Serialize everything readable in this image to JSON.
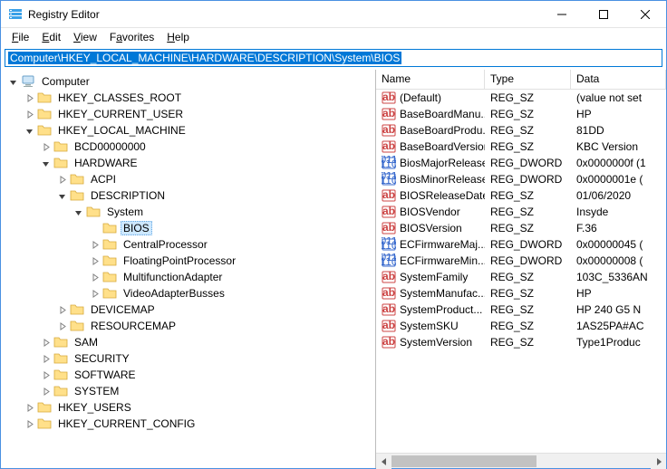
{
  "window": {
    "title": "Registry Editor"
  },
  "menu": {
    "file": "File",
    "edit": "Edit",
    "view": "View",
    "favorites": "Favorites",
    "help": "Help"
  },
  "address": {
    "path": "Computer\\HKEY_LOCAL_MACHINE\\HARDWARE\\DESCRIPTION\\System\\BIOS"
  },
  "tree": [
    {
      "label": "Computer",
      "depth": 0,
      "expanded": true,
      "icon": "computer",
      "selected": false
    },
    {
      "label": "HKEY_CLASSES_ROOT",
      "depth": 1,
      "expanded": false,
      "icon": "folder",
      "hasChildren": true
    },
    {
      "label": "HKEY_CURRENT_USER",
      "depth": 1,
      "expanded": false,
      "icon": "folder",
      "hasChildren": true
    },
    {
      "label": "HKEY_LOCAL_MACHINE",
      "depth": 1,
      "expanded": true,
      "icon": "folder",
      "hasChildren": true
    },
    {
      "label": "BCD00000000",
      "depth": 2,
      "expanded": false,
      "icon": "folder",
      "hasChildren": true
    },
    {
      "label": "HARDWARE",
      "depth": 2,
      "expanded": true,
      "icon": "folder",
      "hasChildren": true
    },
    {
      "label": "ACPI",
      "depth": 3,
      "expanded": false,
      "icon": "folder",
      "hasChildren": true
    },
    {
      "label": "DESCRIPTION",
      "depth": 3,
      "expanded": true,
      "icon": "folder",
      "hasChildren": true
    },
    {
      "label": "System",
      "depth": 4,
      "expanded": true,
      "icon": "folder",
      "hasChildren": true
    },
    {
      "label": "BIOS",
      "depth": 5,
      "expanded": false,
      "icon": "folder",
      "hasChildren": false,
      "selected": true
    },
    {
      "label": "CentralProcessor",
      "depth": 5,
      "expanded": false,
      "icon": "folder",
      "hasChildren": true
    },
    {
      "label": "FloatingPointProcessor",
      "depth": 5,
      "expanded": false,
      "icon": "folder",
      "hasChildren": true
    },
    {
      "label": "MultifunctionAdapter",
      "depth": 5,
      "expanded": false,
      "icon": "folder",
      "hasChildren": true
    },
    {
      "label": "VideoAdapterBusses",
      "depth": 5,
      "expanded": false,
      "icon": "folder",
      "hasChildren": true
    },
    {
      "label": "DEVICEMAP",
      "depth": 3,
      "expanded": false,
      "icon": "folder",
      "hasChildren": true
    },
    {
      "label": "RESOURCEMAP",
      "depth": 3,
      "expanded": false,
      "icon": "folder",
      "hasChildren": true
    },
    {
      "label": "SAM",
      "depth": 2,
      "expanded": false,
      "icon": "folder",
      "hasChildren": true
    },
    {
      "label": "SECURITY",
      "depth": 2,
      "expanded": false,
      "icon": "folder",
      "hasChildren": true
    },
    {
      "label": "SOFTWARE",
      "depth": 2,
      "expanded": false,
      "icon": "folder",
      "hasChildren": true
    },
    {
      "label": "SYSTEM",
      "depth": 2,
      "expanded": false,
      "icon": "folder",
      "hasChildren": true
    },
    {
      "label": "HKEY_USERS",
      "depth": 1,
      "expanded": false,
      "icon": "folder",
      "hasChildren": true
    },
    {
      "label": "HKEY_CURRENT_CONFIG",
      "depth": 1,
      "expanded": false,
      "icon": "folder",
      "hasChildren": true
    }
  ],
  "columns": {
    "name": "Name",
    "type": "Type",
    "data": "Data"
  },
  "values": [
    {
      "name": "(Default)",
      "type": "REG_SZ",
      "data": "(value not set",
      "kind": "sz"
    },
    {
      "name": "BaseBoardManu...",
      "type": "REG_SZ",
      "data": "HP",
      "kind": "sz"
    },
    {
      "name": "BaseBoardProdu...",
      "type": "REG_SZ",
      "data": "81DD",
      "kind": "sz"
    },
    {
      "name": "BaseBoardVersion",
      "type": "REG_SZ",
      "data": "KBC Version ",
      "kind": "sz"
    },
    {
      "name": "BiosMajorRelease",
      "type": "REG_DWORD",
      "data": "0x0000000f (1",
      "kind": "dw"
    },
    {
      "name": "BiosMinorRelease",
      "type": "REG_DWORD",
      "data": "0x0000001e (",
      "kind": "dw"
    },
    {
      "name": "BIOSReleaseDate",
      "type": "REG_SZ",
      "data": "01/06/2020",
      "kind": "sz"
    },
    {
      "name": "BIOSVendor",
      "type": "REG_SZ",
      "data": "Insyde",
      "kind": "sz"
    },
    {
      "name": "BIOSVersion",
      "type": "REG_SZ",
      "data": "F.36",
      "kind": "sz"
    },
    {
      "name": "ECFirmwareMaj...",
      "type": "REG_DWORD",
      "data": "0x00000045 (",
      "kind": "dw"
    },
    {
      "name": "ECFirmwareMin...",
      "type": "REG_DWORD",
      "data": "0x00000008 (",
      "kind": "dw"
    },
    {
      "name": "SystemFamily",
      "type": "REG_SZ",
      "data": "103C_5336AN",
      "kind": "sz"
    },
    {
      "name": "SystemManufac...",
      "type": "REG_SZ",
      "data": "HP",
      "kind": "sz"
    },
    {
      "name": "SystemProduct...",
      "type": "REG_SZ",
      "data": "HP 240 G5 N",
      "kind": "sz"
    },
    {
      "name": "SystemSKU",
      "type": "REG_SZ",
      "data": "1AS25PA#AC",
      "kind": "sz"
    },
    {
      "name": "SystemVersion",
      "type": "REG_SZ",
      "data": "Type1Produc",
      "kind": "sz"
    }
  ]
}
